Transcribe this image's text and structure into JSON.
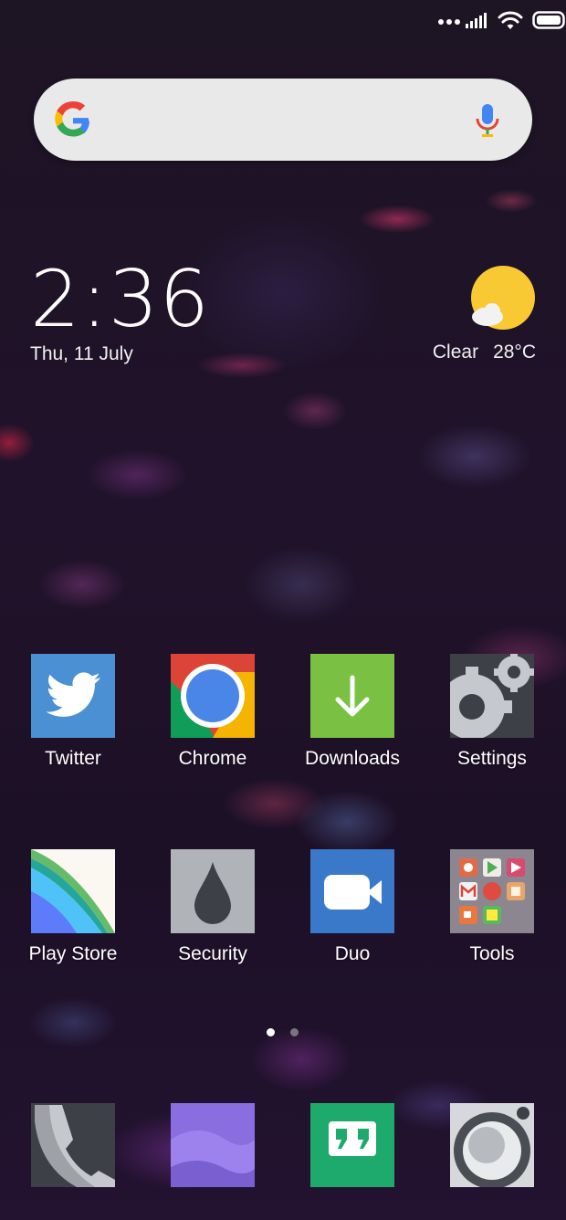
{
  "status_bar": {
    "icons": [
      "more-dots-icon",
      "signal-icon",
      "wifi-icon",
      "battery-icon"
    ]
  },
  "search": {
    "logo": "google-g-icon",
    "mic": "mic-icon"
  },
  "clock": {
    "time": "2:36",
    "date": "Thu, 11 July"
  },
  "weather": {
    "condition": "Clear",
    "temperature": "28°C",
    "icon": "sun-cloud-icon"
  },
  "apps": [
    {
      "label": "Twitter",
      "icon": "twitter-icon"
    },
    {
      "label": "Chrome",
      "icon": "chrome-icon"
    },
    {
      "label": "Downloads",
      "icon": "download-arrow-icon"
    },
    {
      "label": "Settings",
      "icon": "gear-icon"
    },
    {
      "label": "Play Store",
      "icon": "play-store-icon"
    },
    {
      "label": "Security",
      "icon": "security-drop-icon"
    },
    {
      "label": "Duo",
      "icon": "video-camera-icon"
    },
    {
      "label": "Tools",
      "icon": "folder-icon"
    }
  ],
  "pager": {
    "pages": 2,
    "active": 1
  },
  "dock": [
    {
      "icon": "phone-icon"
    },
    {
      "icon": "messaging-icon"
    },
    {
      "icon": "hangouts-icon"
    },
    {
      "icon": "camera-icon"
    }
  ],
  "colors": {
    "twitter": "#4a90d2",
    "chrome_blue": "#4a86e8",
    "downloads": "#7ac143",
    "duo": "#3a78c9",
    "hangouts": "#1faa6d",
    "messaging": "#8a6ee0",
    "weather_sun": "#f9c933"
  }
}
